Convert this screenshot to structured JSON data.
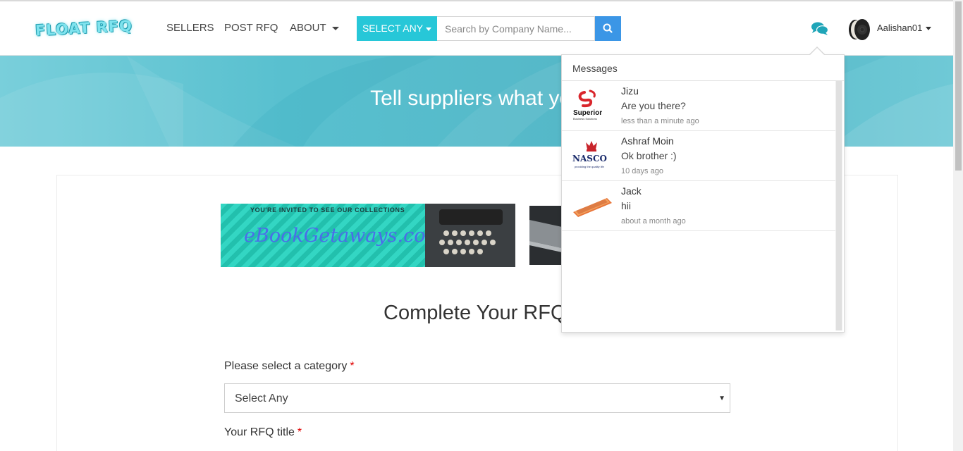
{
  "brand": {
    "logo_text": "FLOAT RFQ"
  },
  "nav": {
    "sellers": "SELLERS",
    "post_rfq": "POST RFQ",
    "about": "ABOUT"
  },
  "search": {
    "category_label": "SELECT ANY",
    "placeholder": "Search by Company Name..."
  },
  "user": {
    "name": "Aalishan01"
  },
  "hero": {
    "title": "Tell suppliers what you"
  },
  "banner": {
    "invite": "YOU'RE INVITED TO SEE OUR COLLECTIONS",
    "brand": "eBookGetaways.com"
  },
  "form": {
    "title": "Complete Your RFQ",
    "category_label": "Please select a category",
    "category_value": "Select Any",
    "rfq_title_label": "Your RFQ title",
    "required_mark": "*"
  },
  "messages": {
    "header": "Messages",
    "items": [
      {
        "name": "Jizu",
        "text": "Are you there?",
        "time": "less than a minute ago",
        "logo": "superior-logo"
      },
      {
        "name": "Ashraf Moin",
        "text": "Ok brother :)",
        "time": "10 days ago",
        "logo": "nasco-logo"
      },
      {
        "name": "Jack",
        "text": "hii",
        "time": "about a month ago",
        "logo": "phone-image"
      }
    ]
  },
  "colors": {
    "accent_teal": "#27c7d8",
    "search_blue": "#3b96e6",
    "hero_teal": "#58c0cf",
    "required_red": "#e00000"
  }
}
